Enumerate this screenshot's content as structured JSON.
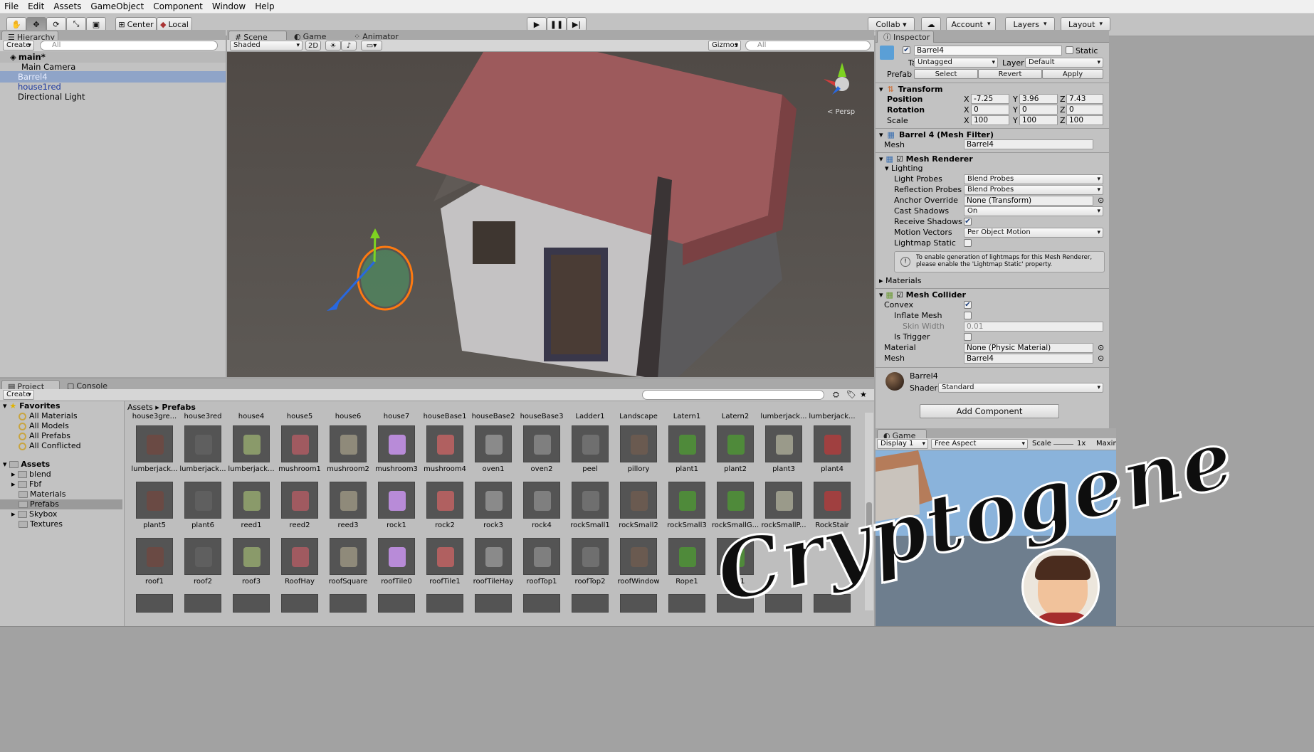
{
  "menu": [
    "File",
    "Edit",
    "Assets",
    "GameObject",
    "Component",
    "Window",
    "Help"
  ],
  "toolbar": {
    "center": "Center",
    "local": "Local",
    "collab": "Collab ▾",
    "account": "Account",
    "layers": "Layers",
    "layout": "Layout"
  },
  "hierarchy": {
    "tab": "Hierarchy",
    "create": "Create",
    "search": "All",
    "scene": "main*",
    "items": [
      "Main Camera",
      "Barrel4",
      "house1red",
      "Directional Light"
    ]
  },
  "scene": {
    "tabs": [
      "Scene",
      "Game",
      "Animator"
    ],
    "shading": "Shaded",
    "mode2d": "2D",
    "gizmos": "Gizmos",
    "search": "All",
    "persp": "< Persp"
  },
  "inspector": {
    "tab": "Inspector",
    "name": "Barrel4",
    "static": "Static",
    "tag_label": "Tag",
    "tag": "Untagged",
    "layer_label": "Layer",
    "layer": "Default",
    "prefab_label": "Prefab",
    "select": "Select",
    "revert": "Revert",
    "apply": "Apply",
    "transform": {
      "title": "Transform",
      "pos_label": "Position",
      "rot_label": "Rotation",
      "scale_label": "Scale",
      "x": "X",
      "y": "Y",
      "z": "Z",
      "pos": [
        "-7.25",
        "3.96",
        "7.43"
      ],
      "rot": [
        "0",
        "0",
        "0"
      ],
      "scale": [
        "100",
        "100",
        "100"
      ]
    },
    "meshfilter": {
      "title": "Barrel 4 (Mesh Filter)",
      "mesh_label": "Mesh",
      "mesh": "Barrel4"
    },
    "renderer": {
      "title": "Mesh Renderer",
      "lighting": "Lighting",
      "rows": [
        {
          "label": "Light Probes",
          "value": "Blend Probes"
        },
        {
          "label": "Reflection Probes",
          "value": "Blend Probes"
        },
        {
          "label": "Anchor Override",
          "value": "None (Transform)"
        },
        {
          "label": "Cast Shadows",
          "value": "On"
        },
        {
          "label": "Receive Shadows",
          "value": "✔"
        },
        {
          "label": "Motion Vectors",
          "value": "Per Object Motion"
        },
        {
          "label": "Lightmap Static",
          "value": ""
        }
      ],
      "note": "To enable generation of lightmaps for this Mesh Renderer, please enable the 'Lightmap Static' property.",
      "materials": "Materials"
    },
    "collider": {
      "title": "Mesh Collider",
      "convex": "Convex",
      "inflate": "Inflate Mesh",
      "skin": "Skin Width",
      "skin_value": "0.01",
      "trigger": "Is Trigger",
      "material_label": "Material",
      "material": "None (Physic Material)",
      "mesh_label": "Mesh",
      "mesh": "Barrel4"
    },
    "material": {
      "name": "Barrel4",
      "shader_label": "Shader",
      "shader": "Standard"
    },
    "add_component": "Add Component"
  },
  "game": {
    "tab": "Game",
    "display": "Display 1",
    "aspect": "Free Aspect",
    "scale": "Scale",
    "scale_value": "1x",
    "maximize": "Maxim"
  },
  "project": {
    "tabs": [
      "Project",
      "Console"
    ],
    "create": "Create",
    "breadcrumb": [
      "Assets",
      "Prefabs"
    ],
    "favorites": {
      "label": "Favorites",
      "items": [
        "All Materials",
        "All Models",
        "All Prefabs",
        "All Conflicted"
      ]
    },
    "assets": {
      "label": "Assets",
      "items": [
        "blend",
        "Fbf",
        "Materials",
        "Prefabs",
        "Skybox",
        "Textures"
      ]
    },
    "header_labels": [
      "house3gre...",
      "house3red",
      "house4",
      "house5",
      "house6",
      "house7",
      "houseBase1",
      "houseBase2",
      "houseBase3",
      "Ladder1",
      "Landscape",
      "Latern1",
      "Latern2",
      "lumberjack...",
      "lumberjack..."
    ],
    "rows": [
      [
        "lumberjack...",
        "lumberjack...",
        "lumberjack...",
        "mushroom1",
        "mushroom2",
        "mushroom3",
        "mushroom4",
        "oven1",
        "oven2",
        "peel",
        "pillory",
        "plant1",
        "plant2",
        "plant3",
        "plant4"
      ],
      [
        "plant5",
        "plant6",
        "reed1",
        "reed2",
        "reed3",
        "rock1",
        "rock2",
        "rock3",
        "rock4",
        "rockSmall1",
        "rockSmall2",
        "rockSmall3",
        "rockSmallG...",
        "rockSmallP...",
        "RockStair"
      ],
      [
        "roof1",
        "roof2",
        "roof3",
        "RoofHay",
        "roofSquare",
        "roofTile0",
        "roofTile1",
        "roofTileHay",
        "roofTop1",
        "roofTop2",
        "roofWindow",
        "Rope1",
        "sign1",
        "",
        ""
      ]
    ]
  },
  "watermark": "Cryptogene"
}
